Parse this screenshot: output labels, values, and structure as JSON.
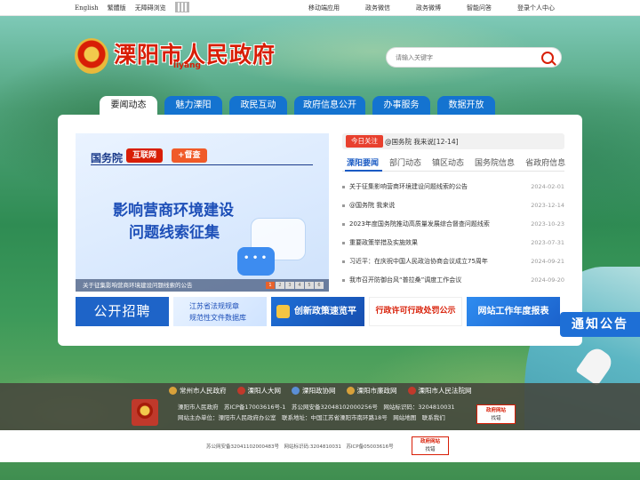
{
  "topbar": {
    "english": "English",
    "traditional": "繁體版",
    "accessible": "无障碍浏览",
    "mobile": "移动端应用",
    "wechat": "政务微信",
    "weibo": "政务微博",
    "smart_qa": "智能问答",
    "login": "登录个人中心"
  },
  "header": {
    "title": "溧阳市人民政府",
    "subtitle": "liyang",
    "search_placeholder": "请输入关键字"
  },
  "nav": {
    "tabs": [
      "要闻动态",
      "魅力溧阳",
      "政民互动",
      "政府信息公开",
      "办事服务",
      "数据开放"
    ]
  },
  "banner": {
    "source": "国务院",
    "tag1": "互联网",
    "tag2": "+督查",
    "headline1": "影响营商环境建设",
    "headline2": "问题线索征集",
    "caption": "关于征集影响营商环境建设问题线索的公告",
    "pages": [
      "1",
      "2",
      "3",
      "4",
      "5",
      "6"
    ]
  },
  "focus": {
    "label": "今日关注",
    "text": "@国务院 我来说[12-14]"
  },
  "news_tabs": [
    "溧阳要闻",
    "部门动态",
    "镇区动态",
    "国务院信息",
    "省政府信息"
  ],
  "news": [
    {
      "title": "关于征集影响营商环境建设问题线索的公告",
      "date": "2024-02-01"
    },
    {
      "title": "@国务院 我来说",
      "date": "2023-12-14"
    },
    {
      "title": "2023年度国务院推动高质量发展综合督查问题线索",
      "date": "2023-10-23"
    },
    {
      "title": "重要政策举措及实施效果",
      "date": "2023-07-31"
    },
    {
      "title": "习近平：在庆祝中国人民政治协商会议成立75周年",
      "date": "2024-09-21"
    },
    {
      "title": "我市召开防御台风“普拉桑”调度工作会议",
      "date": "2024-09-20"
    }
  ],
  "features": {
    "recruit": "公开招聘",
    "regulation_line1": "江苏省法规规章",
    "regulation_line2": "规范性文件数据库",
    "policy": "创新政策速览平台",
    "admin": "行政许可行政处罚公示",
    "annual": "网站工作年度报表"
  },
  "notice": "通知公告",
  "footer": {
    "links": [
      "常州市人民政府",
      "溧阳人大网",
      "溧阳政协网",
      "溧阳市廉政网",
      "溧阳市人民法院网"
    ],
    "line1": "溧阳市人民政府　苏ICP备17003616号-1　苏公网安备32048102000256号　网站标识码：3204810031",
    "line2": "网站主办单位：溧阳市人民政府办公室　联系地址：中国江苏省溧阳市南环路18号　网站地图　联系我们",
    "jiucuo_top": "政府网站",
    "jiucuo_bottom": "找错",
    "bottom_text": "苏公网安备32041102000483号　网站标识码:3204810031　苏ICP备05003616号"
  }
}
